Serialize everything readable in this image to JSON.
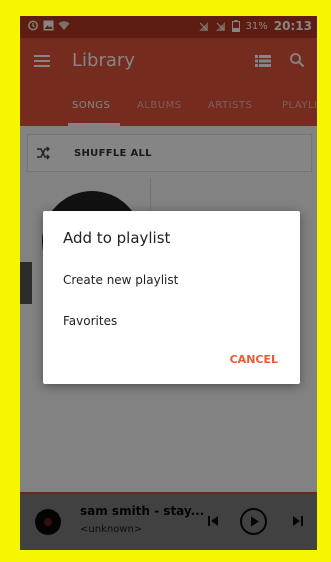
{
  "status_bar": {
    "battery_percent": "31%",
    "time": "20:13"
  },
  "app_bar": {
    "title": "Library"
  },
  "tabs": [
    {
      "label": "SONGS",
      "active": true
    },
    {
      "label": "ALBUMS",
      "active": false
    },
    {
      "label": "ARTISTS",
      "active": false
    },
    {
      "label": "PLAYLIS",
      "active": false
    }
  ],
  "shuffle": {
    "label": "SHUFFLE ALL"
  },
  "dialog": {
    "title": "Add to playlist",
    "items": [
      {
        "label": "Create new playlist"
      },
      {
        "label": "Favorites"
      }
    ],
    "cancel_label": "CANCEL"
  },
  "now_playing": {
    "title": "sam smith - stay...",
    "artist": "<unknown>"
  },
  "colors": {
    "app_bar": "#e0533a",
    "status_bar": "#b23b22",
    "accent": "#ea5a36",
    "frame": "#f6f600"
  }
}
